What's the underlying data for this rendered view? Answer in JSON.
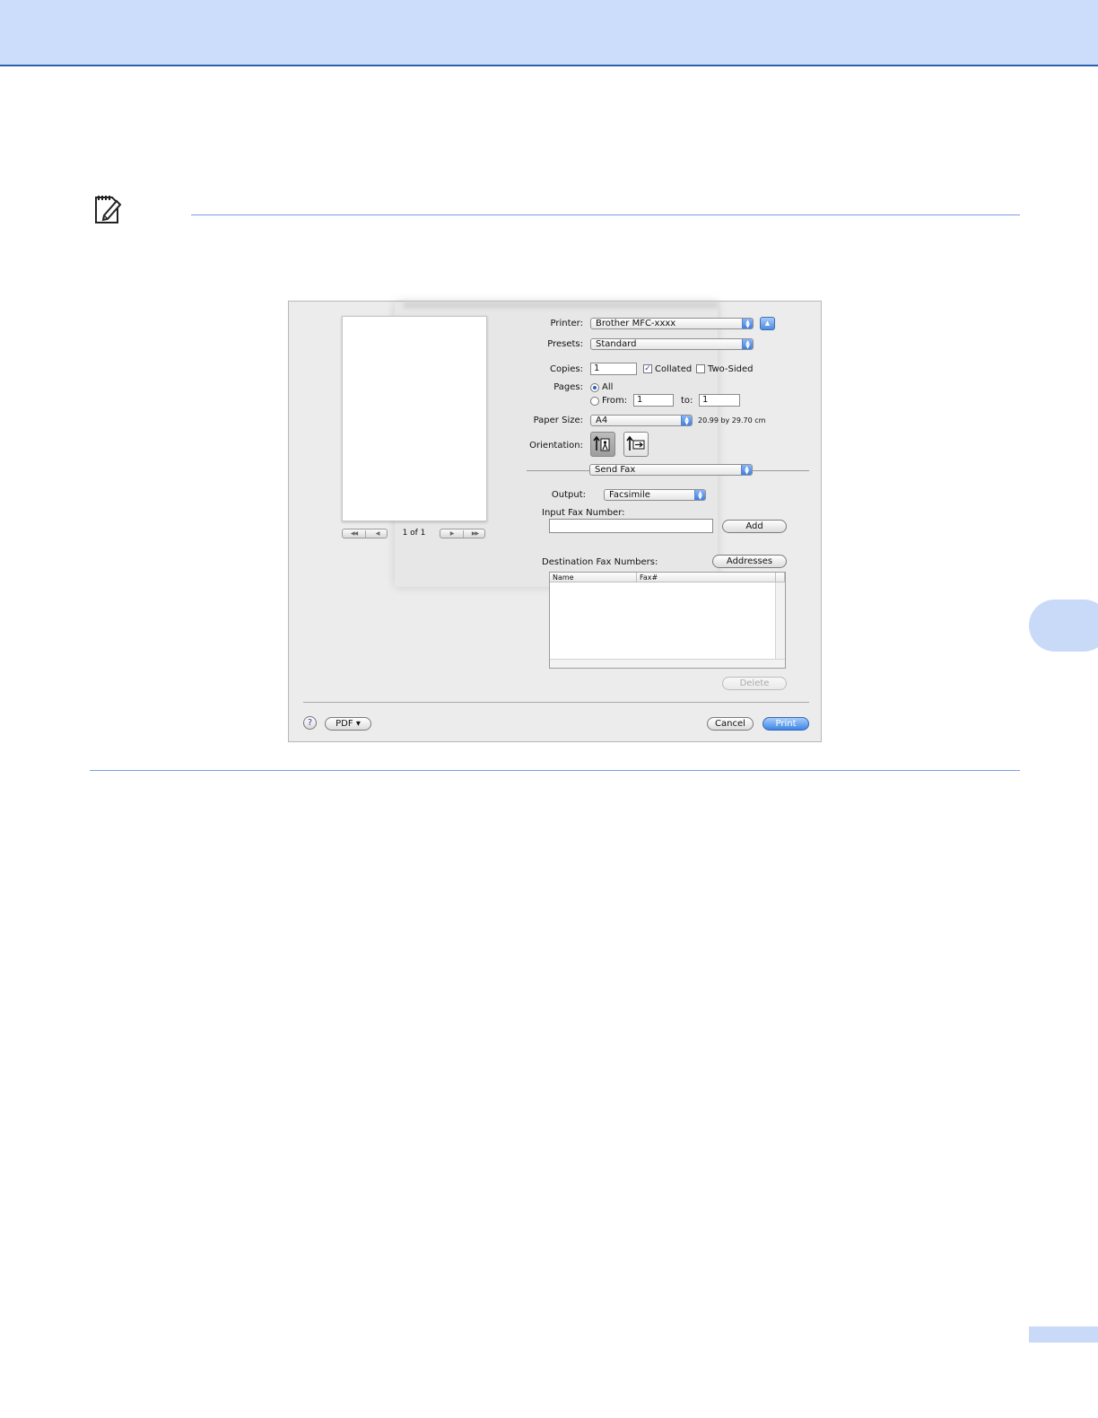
{
  "dialog": {
    "preview": {
      "page_count": "1 of 1",
      "first_glyph": "◀◀",
      "prev_glyph": "◀",
      "next_glyph": "▶",
      "last_glyph": "▶▶"
    },
    "printer": {
      "label": "Printer:",
      "value": "Brother MFC-xxxx"
    },
    "presets": {
      "label": "Presets:",
      "value": "Standard"
    },
    "copies": {
      "label": "Copies:",
      "value": "1",
      "collated_label": "Collated",
      "collated": true,
      "two_sided_label": "Two-Sided",
      "two_sided": false
    },
    "pages": {
      "label": "Pages:",
      "all_label": "All",
      "from_label": "From:",
      "from_value": "1",
      "to_label": "to:",
      "to_value": "1",
      "selected": "all"
    },
    "paper_size": {
      "label": "Paper Size:",
      "value": "A4",
      "dimensions": "20.99 by 29.70 cm"
    },
    "orientation": {
      "label": "Orientation:",
      "selected": "portrait"
    },
    "panel_menu": {
      "value": "Send Fax"
    },
    "output": {
      "label": "Output:",
      "value": "Facsimile"
    },
    "fax_input": {
      "label": "Input Fax Number:",
      "value": "",
      "add_label": "Add"
    },
    "destination": {
      "label": "Destination Fax Numbers:",
      "addresses_label": "Addresses",
      "columns": [
        "Name",
        "Fax#"
      ],
      "rows": [],
      "delete_label": "Delete"
    },
    "footer": {
      "help_glyph": "?",
      "pdf_label": "PDF ▾",
      "cancel_label": "Cancel",
      "print_label": "Print"
    }
  },
  "colors": {
    "top_band": "#ccdcfb",
    "rule": "#7f9ee6",
    "accent": "#3d86e6"
  }
}
